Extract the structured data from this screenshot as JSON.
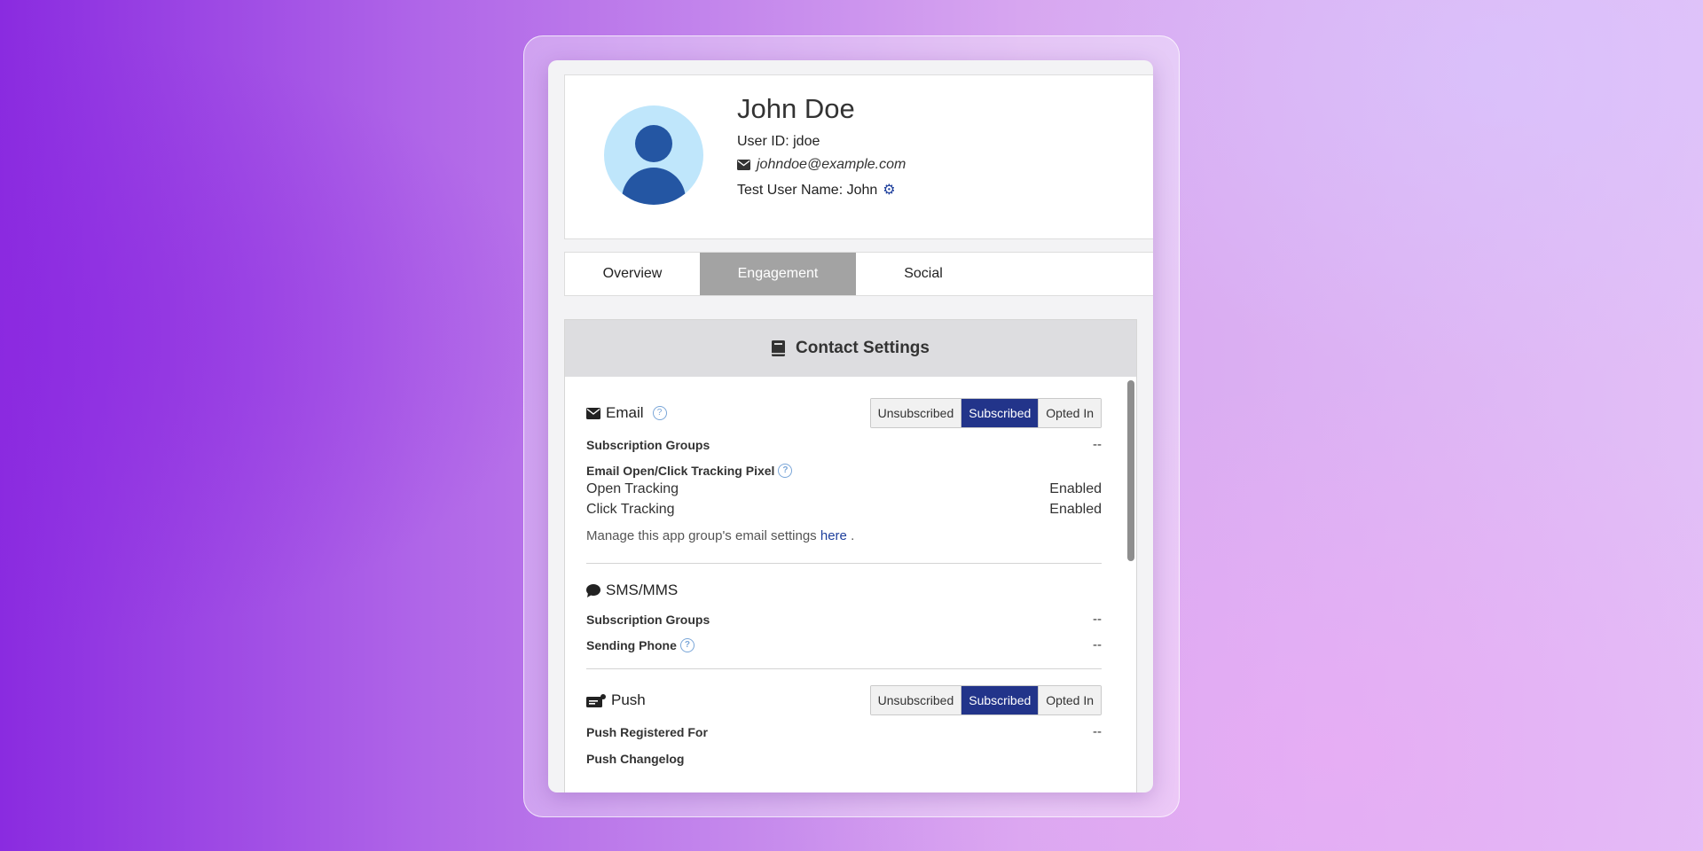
{
  "profile": {
    "name": "John Doe",
    "user_id": "User ID: jdoe",
    "email": "johndoe@example.com",
    "test_user": "Test User Name: John"
  },
  "tabs": [
    {
      "label": "Overview",
      "active": false
    },
    {
      "label": "Engagement",
      "active": true
    },
    {
      "label": "Social",
      "active": false
    }
  ],
  "contact_settings": {
    "title": "Contact Settings",
    "email": {
      "title": "Email",
      "options": [
        "Unsubscribed",
        "Subscribed",
        "Opted In"
      ],
      "selected": "Subscribed",
      "subscription_groups_label": "Subscription Groups",
      "subscription_groups_value": "--",
      "tracking_pixel_label": "Email Open/Click Tracking Pixel",
      "open_tracking_label": "Open Tracking",
      "open_tracking_value": "Enabled",
      "click_tracking_label": "Click Tracking",
      "click_tracking_value": "Enabled",
      "manage_text": "Manage this app group's email settings",
      "manage_link": "here",
      "manage_end": "."
    },
    "sms": {
      "title": "SMS/MMS",
      "subscription_groups_label": "Subscription Groups",
      "subscription_groups_value": "--",
      "sending_phone_label": "Sending Phone",
      "sending_phone_value": "--"
    },
    "push": {
      "title": "Push",
      "options": [
        "Unsubscribed",
        "Subscribed",
        "Opted In"
      ],
      "selected": "Subscribed",
      "registered_label": "Push Registered For",
      "registered_value": "--",
      "changelog_label": "Push Changelog"
    }
  },
  "colors": {
    "accent": "#22348a",
    "avatar_bg": "#bfe6fb",
    "avatar_fg": "#2456a3",
    "tab_active": "#a3a3a3"
  }
}
